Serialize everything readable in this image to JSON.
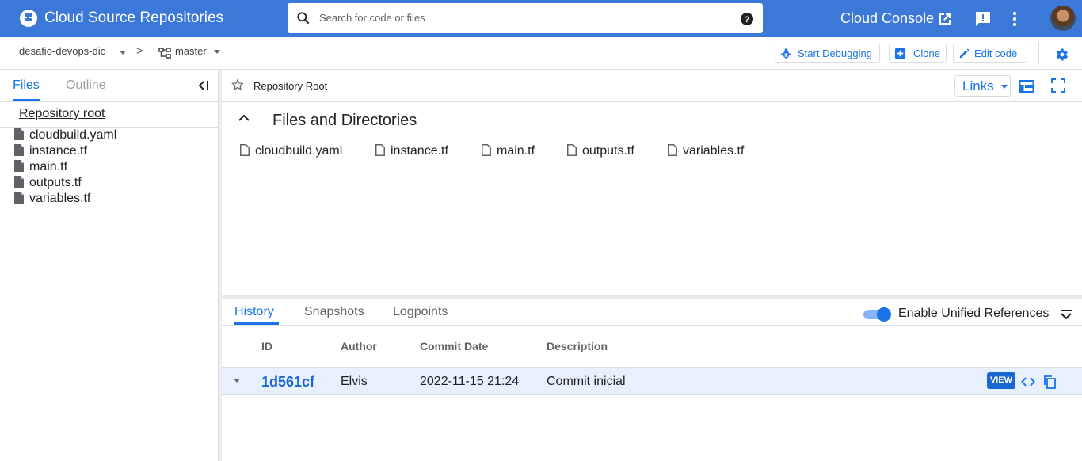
{
  "header": {
    "app_title": "Cloud Source Repositories",
    "search_placeholder": "Search for code or files",
    "console_link": "Cloud Console",
    "icons": [
      "logo-icon",
      "search-icon",
      "help-icon",
      "external-link-icon",
      "feedback-icon",
      "more-vert-icon",
      "avatar"
    ]
  },
  "breadcrumb": {
    "repo": "desafio-devops-dio",
    "separator": ">",
    "branch": "master"
  },
  "toolbar": {
    "debug_label": "Start Debugging",
    "clone_label": "Clone",
    "edit_label": "Edit code"
  },
  "sidebar": {
    "tabs": [
      {
        "label": "Files",
        "active": true
      },
      {
        "label": "Outline",
        "active": false
      }
    ],
    "root_label": "Repository root",
    "files": [
      "cloudbuild.yaml",
      "instance.tf",
      "main.tf",
      "outputs.tf",
      "variables.tf"
    ]
  },
  "main": {
    "title": "Repository Root",
    "links_label": "Links",
    "section_title": "Files and Directories",
    "files": [
      "cloudbuild.yaml",
      "instance.tf",
      "main.tf",
      "outputs.tf",
      "variables.tf"
    ]
  },
  "bottom": {
    "tabs": [
      {
        "label": "History",
        "active": true
      },
      {
        "label": "Snapshots",
        "active": false
      },
      {
        "label": "Logpoints",
        "active": false
      }
    ],
    "toggle_label": "Enable Unified References",
    "toggle_on": true,
    "columns": [
      "ID",
      "Author",
      "Commit Date",
      "Description"
    ],
    "commits": [
      {
        "id": "1d561cf",
        "author": "Elvis",
        "date": "2022-11-15 21:24",
        "description": "Commit inicial",
        "view_label": "VIEW"
      }
    ]
  },
  "colors": {
    "topbar": "#3c78d8",
    "accent": "#1a73e8",
    "row_highlight": "#e8f0fe"
  }
}
